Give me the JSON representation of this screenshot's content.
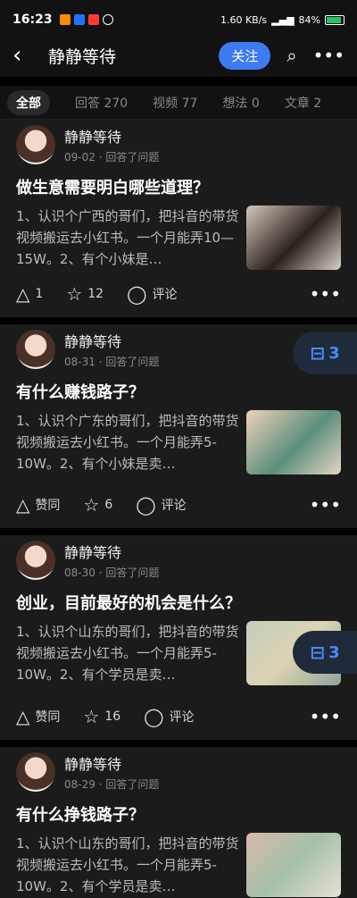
{
  "status": {
    "time": "16:23",
    "net_rate": "1.60 KB/s",
    "battery": "84%"
  },
  "header": {
    "back": "‹",
    "title": "静静等待",
    "follow": "关注"
  },
  "tabs": [
    "全部",
    "回答 270",
    "视频 77",
    "想法 0",
    "文章 2"
  ],
  "posts": [
    {
      "author": "静静等待",
      "date": "09-02",
      "action": "回答了问题",
      "question": "做生意需要明白哪些道理？",
      "excerpt": "1、认识个广西的哥们，把抖音的带货视频搬运去小红书。一个月能弄10—15W。2、有个小妹是…",
      "upvote": "1",
      "favorite": "12",
      "comment": "评论"
    },
    {
      "author": "静静等待",
      "date": "08-31",
      "action": "回答了问题",
      "question": "有什么赚钱路子？",
      "excerpt": "1、认识个广东的哥们，把抖音的带货视频搬运去小红书。一个月能弄5-10W。2、有个小妹是卖…",
      "upvote": "赞同",
      "favorite": "6",
      "comment": "评论"
    },
    {
      "author": "静静等待",
      "date": "08-30",
      "action": "回答了问题",
      "question": "创业，目前最好的机会是什么？",
      "excerpt": "1、认识个山东的哥们，把抖音的带货视频搬运去小红书。一个月能弄5-10W。2、有个学员是卖…",
      "upvote": "赞同",
      "favorite": "16",
      "comment": "评论"
    },
    {
      "author": "静静等待",
      "date": "08-29",
      "action": "回答了问题",
      "question": "有什么挣钱路子？",
      "excerpt": "1、认识个山东的哥们，把抖音的带货视频搬运去小红书。一个月能弄5-10W。2、有个学员是卖…"
    }
  ],
  "float_badge": {
    "count": "3"
  }
}
